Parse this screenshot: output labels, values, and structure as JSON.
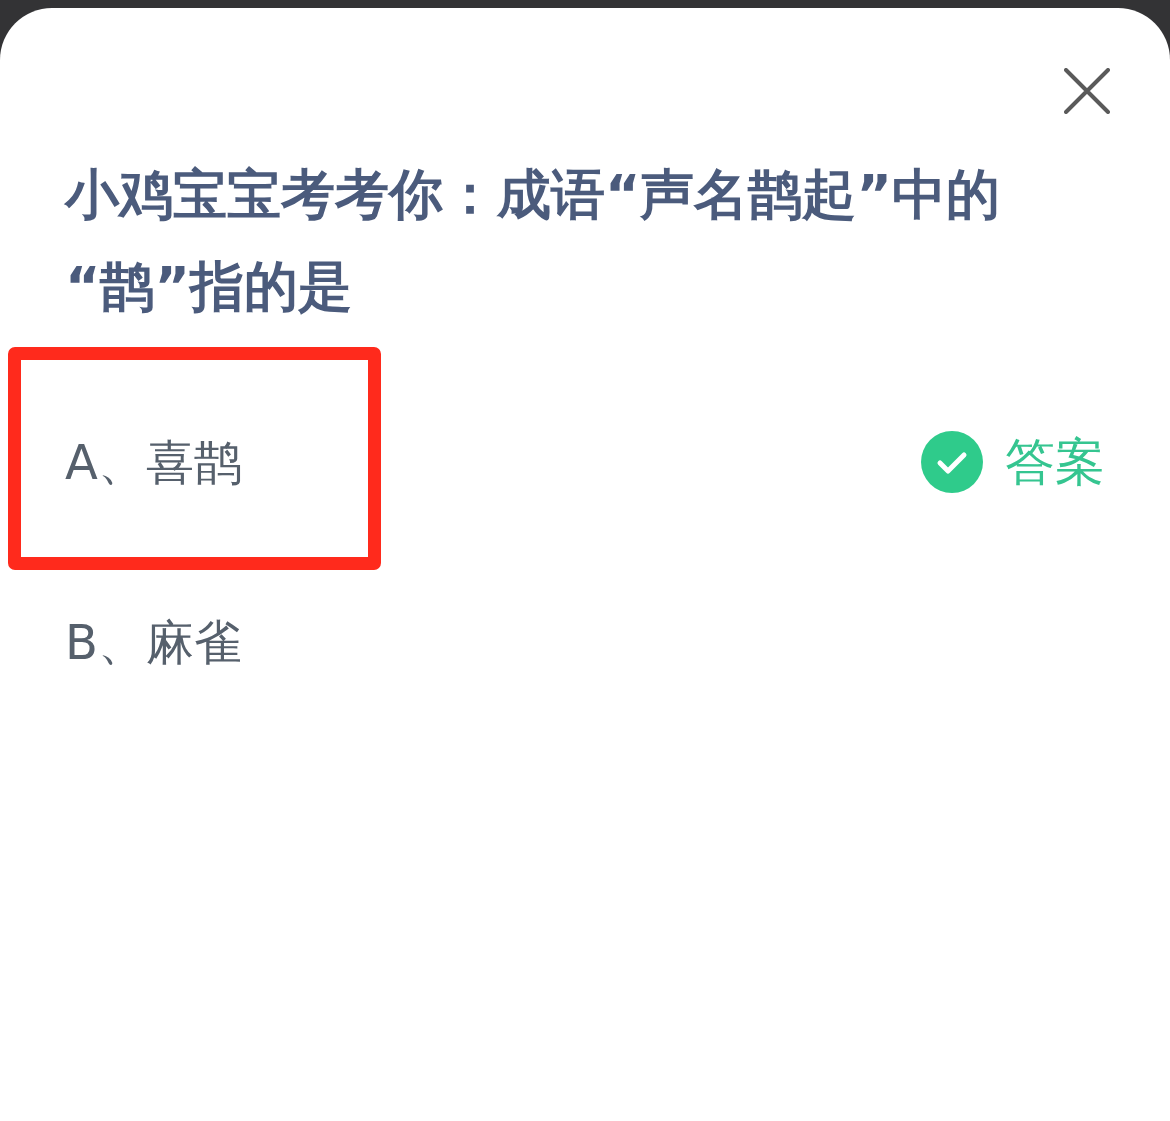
{
  "question": "小鸡宝宝考考你：成语“声名鹊起”中的“鹊”指的是",
  "options": [
    {
      "label": "A、喜鹊",
      "highlighted": true,
      "correct": true
    },
    {
      "label": "B、麻雀",
      "highlighted": false,
      "correct": false
    }
  ],
  "answer_label": "答案"
}
